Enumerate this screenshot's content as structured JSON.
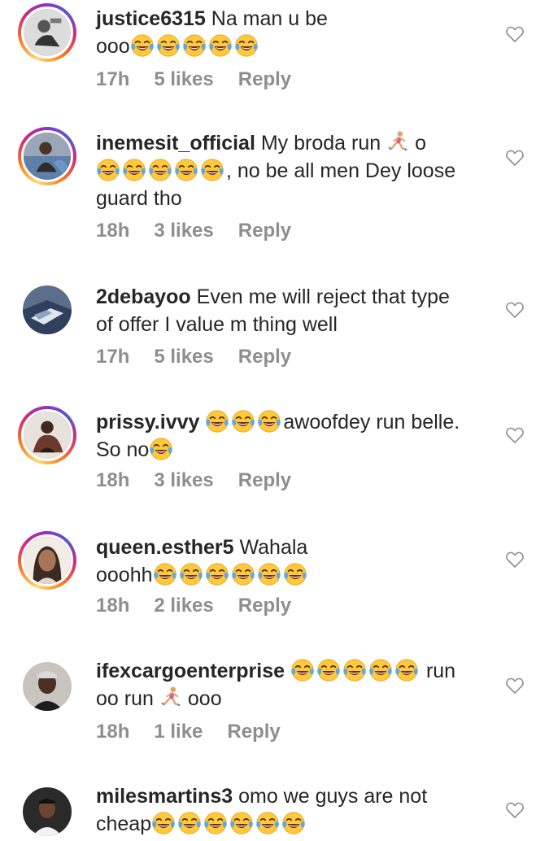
{
  "comments": [
    {
      "username": "justice6315",
      "lines": [
        [
          "Na man u be"
        ],
        [
          "ooo",
          "laugh",
          "laugh",
          "laugh",
          "laugh",
          "laugh"
        ]
      ],
      "time": "17h",
      "likes": "5 likes",
      "reply": "Reply",
      "avatar_story": true
    },
    {
      "username": "inemesit_official",
      "lines": [
        [
          "My broda run",
          "runner",
          "o"
        ],
        [
          "laugh",
          "laugh",
          "laugh",
          "laugh",
          "laugh",
          ", no be all men Dey loose"
        ],
        [
          "guard tho"
        ]
      ],
      "time": "18h",
      "likes": "3 likes",
      "reply": "Reply",
      "avatar_story": true
    },
    {
      "username": "2debayoo",
      "lines": [
        [
          "Even me will reject that type"
        ],
        [
          "of offer I value m thing well"
        ]
      ],
      "time": "17h",
      "likes": "5 likes",
      "reply": "Reply",
      "avatar_story": false
    },
    {
      "username": "prissy.ivvy",
      "lines": [
        [
          "laugh",
          "laugh",
          "laugh",
          "awoofdey run belle."
        ],
        [
          "So no",
          "laugh"
        ]
      ],
      "time": "18h",
      "likes": "3 likes",
      "reply": "Reply",
      "avatar_story": true
    },
    {
      "username": "queen.esther5",
      "lines": [
        [
          "Wahala"
        ],
        [
          "ooohh",
          "laugh",
          "laugh",
          "laugh",
          "laugh",
          "laugh",
          "laugh"
        ]
      ],
      "time": "18h",
      "likes": "2 likes",
      "reply": "Reply",
      "avatar_story": true
    },
    {
      "username": "ifexcargoenterprise",
      "lines": [
        [
          "laugh",
          "laugh",
          "laugh",
          "laugh",
          "laugh",
          " run"
        ],
        [
          "oo run",
          "runner",
          "ooo"
        ]
      ],
      "time": "18h",
      "likes": "1 like",
      "reply": "Reply",
      "avatar_story": false
    },
    {
      "username": "milesmartins3",
      "lines": [
        [
          "omo we guys are not"
        ],
        [
          "cheap",
          "laugh",
          "laugh",
          "laugh",
          "laugh",
          "laugh",
          "laugh"
        ]
      ],
      "time": "",
      "likes": "",
      "reply": "",
      "avatar_story": false
    }
  ],
  "icons": {
    "laugh": "face-with-tears-of-joy-icon",
    "runner": "woman-running-icon",
    "like": "heart-outline-icon"
  },
  "colors": {
    "text": "#262626",
    "meta": "#8e8e8e",
    "emoji_face": "#FFC83D"
  }
}
